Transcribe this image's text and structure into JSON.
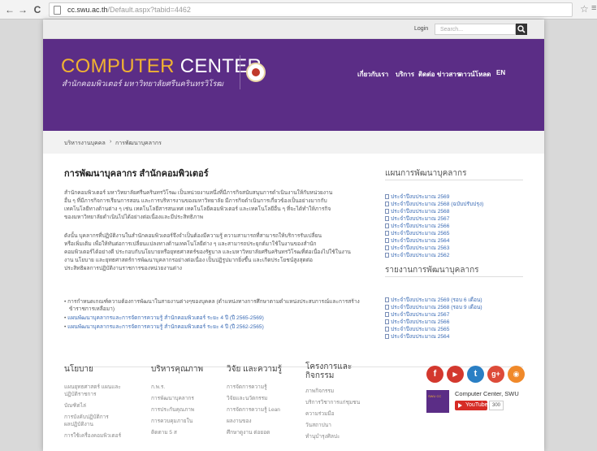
{
  "browser": {
    "back": "←",
    "forward": "→",
    "reload": "C",
    "url_host": "cc.swu.ac.th",
    "url_path": "/Default.aspx?tabid=4462",
    "bookmark_star": "☆",
    "menu": "≡"
  },
  "topbar": {
    "login_label": "Login",
    "search_placeholder": "Search..."
  },
  "header": {
    "title_part1": "COMPUTER",
    "title_part2": " CENTER",
    "subtitle": "สำนักคอมพิวเตอร์ มหาวิทยาลัยศรีนครินทรวิโรฒ",
    "nav": [
      "เกี่ยวกับเรา",
      "บริการ",
      "ติดต่อ",
      "ข่าวสาร",
      "ดาวน์โหลด",
      "EN"
    ]
  },
  "breadcrumb": [
    "บริหารงานบุคคล",
    "›",
    "การพัฒนาบุคลากร"
  ],
  "main": {
    "title": "การพัฒนาบุคลากร สำนักคอมพิวเตอร์",
    "paragraph1": [
      "สำนักคอมพิวเตอร์ มหาวิทยาลัยศรีนครินทรวิโรฒ เป็นหน่วยงานหนึ่งที่มีภารกิจสนับสนุนการดำเนินงานให้กับหน่วยงาน",
      "อื่น ๆ ที่มีภารกิจการเรียนการสอน และการบริหารงานของมหาวิทยาลัย มีภารกิจดำเนินการเกี่ยวข้องเป็นอย่างมากกับ",
      "เทคโนโลยีทางด้านต่าง ๆ เช่น เทคโนโลยีสารสนเทศ เทคโนโลยีคอมพิวเตอร์ และเทคโนโลยีอื่น ๆ ที่จะได้ทำให้ภารกิจ",
      "ของมหาวิทยาลัยดำเนินไปได้อย่างต่อเนื่องและมีประสิทธิภาพ"
    ],
    "paragraph2": [
      "ดังนั้น บุคลากรที่ปฏิบัติงานในสำนักคอมพิวเตอร์จึงจำเป็นต้องมีความรู้ ความสามารถที่สามารถให้บริการรับเปลี่ยน",
      "หรือเพิ่มเติม เพื่อให้ทันต่อการเปลี่ยนแปลงทางด้านเทคโนโลยีต่าง ๆ และสามารถประยุกต์มาใช้ในงานของสำนัก",
      "คอมพิวเตอร์ได้อย่างดี ประกอบกับนโยบายหรือยุทธศาสตร์ของรัฐบาล และมหาวิทยาลัยศรีนครินทรวิโรฒที่ต่อเนื่องไปใช้ในงาน",
      "งาน นโยบาย และยุทธศาสตร์การพัฒนาบุคลากรอย่างต่อเนื่อง เป็นปฏิรูปมากยิ่งขึ้น และเกิดประโยชน์สูงสุดต่อ",
      "ประสิทธิผลการปฏิบัติงานราชการของหน่วยงานต่าง"
    ],
    "bullets": [
      {
        "text": "การกำหนดเกณฑ์ความต้องการพัฒนาในสายงานต่างๆของบุคคล (ตำแหน่งทางการศึกษาตามตำแหน่งประสบการณ์และการสร้าง",
        "link": "",
        "tail": ""
      },
      {
        "text": "ข้าราชการเหลือมา)",
        "link": "",
        "tail": ""
      },
      {
        "text": "",
        "link": "แผนพัฒนาบุคลากรและการจัดการความรู้ สำนักคอมพิวเตอร์ ระยะ 4 ปี",
        "tail": " (ปี 2565-2569)"
      },
      {
        "text": "",
        "link": "แผนพัฒนาบุคลากรและการจัดการความรู้ สำนักคอมพิวเตอร์ ระยะ 4 ปี",
        "tail": " (ปี 2562-2565)"
      }
    ]
  },
  "sidebar": {
    "plan_title": "แผนการพัฒนาบุคลากร",
    "plan_items": [
      "ประจำปีงบประมาณ 2569",
      "ประจำปีงบประมาณ 2568 (ฉบับปรับปรุง)",
      "ประจำปีงบประมาณ 2568",
      "ประจำปีงบประมาณ 2567",
      "ประจำปีงบประมาณ 2566",
      "ประจำปีงบประมาณ 2565",
      "ประจำปีงบประมาณ 2564",
      "ประจำปีงบประมาณ 2563",
      "ประจำปีงบประมาณ 2562"
    ],
    "report_title": "รายงานการพัฒนาบุคลากร",
    "report_items": [
      "ประจำปีงบประมาณ 2569 (รอบ 6 เดือน)",
      "ประจำปีงบประมาณ 2568 (รอบ 9 เดือน)",
      "ประจำปีงบประมาณ 2567",
      "ประจำปีงบประมาณ 2566",
      "ประจำปีงบประมาณ 2565",
      "ประจำปีงบประมาณ 2564"
    ]
  },
  "footer": {
    "columns": [
      {
        "heading": "นโยบาย",
        "items": [
          "แผนยุทธศาสตร์ แผนและ",
          "ปฏิบัติราชการ",
          "บัณฑิตไล่",
          "การบังคับปฏิบัติการ",
          "ผลปฏิบัติงาน",
          "การใช้เครื่องคอมพิวเตอร์"
        ]
      },
      {
        "heading": "บริหารคุณภาพ",
        "items": [
          "ก.พ.ร.",
          "การพัฒนาบุคลากร",
          "การประกันคุณภาพ",
          "การควบคุมภายใน",
          "ติดตาม 5 ส"
        ]
      },
      {
        "heading": "วิจัย และความรู้",
        "items": [
          "การจัดการความรู้",
          "วิจัยและนวัตกรรม",
          "การจัดการความรู้ Lean",
          "ผลงานของ",
          "ศึกษาดูงาน ต่อยอด"
        ]
      },
      {
        "heading": "โครงการและกิจกรรม",
        "items": [
          "ภาพกิจกรรม",
          "บริการวิชาการแก่ชุมชน",
          "ความร่วมมือ",
          "วันสถาปนา",
          "ทำนุบำรุงศิลปะ"
        ]
      }
    ],
    "social": [
      {
        "name": "facebook",
        "glyph": "f",
        "color": "#d3382e"
      },
      {
        "name": "youtube",
        "glyph": "▶",
        "color": "#d3382e"
      },
      {
        "name": "twitter",
        "glyph": "t",
        "color": "#2a7fc4"
      },
      {
        "name": "google-plus",
        "glyph": "g+",
        "color": "#dd4b39"
      },
      {
        "name": "rss",
        "glyph": "◉",
        "color": "#f0892a"
      }
    ],
    "channel_name": "Computer Center, SWU",
    "youtube_label": "YouTube",
    "subscriber_count": "300"
  }
}
